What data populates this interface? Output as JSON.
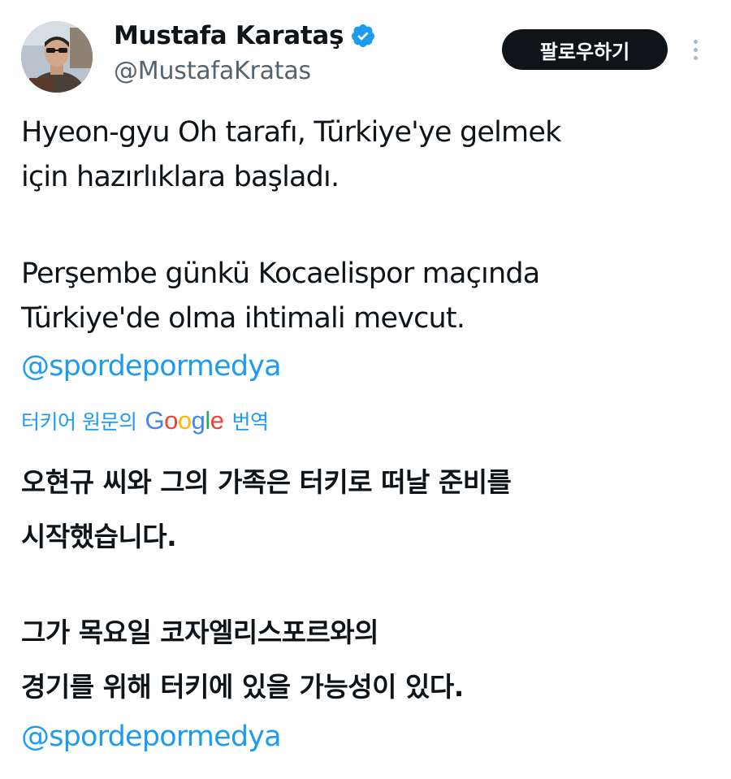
{
  "author": {
    "display_name": "Mustafa Karataş",
    "handle": "@MustafaKratas",
    "verified": true,
    "avatar_icon": "profile-photo"
  },
  "actions": {
    "follow_label": "팔로우하기",
    "more_icon": "more-vertical-icon"
  },
  "original": {
    "lines": [
      "Hyeon-gyu Oh tarafı, Türkiye'ye gelmek",
      "için hazırlıklara başladı.",
      "",
      "Perşembe günkü Kocaelispor maçında",
      "Türkiye'de olma ihtimali mevcut."
    ],
    "mention": "@spordepormedya"
  },
  "translation": {
    "prefix": "터키어 원문의",
    "provider": "Google",
    "suffix": "번역",
    "lines": [
      "오현규 씨와 그의 가족은 터키로 떠날 준비를",
      "시작했습니다.",
      "",
      "그가 목요일 코자엘리스포르와의",
      "경기를 위해 터키에 있을 가능성이 있다."
    ],
    "mention": "@spordepormedya"
  },
  "colors": {
    "link": "#1d9bf0",
    "text": "#0f1419",
    "secondary": "#536471",
    "button_bg": "#0f1419",
    "verified": "#1d9bf0"
  }
}
